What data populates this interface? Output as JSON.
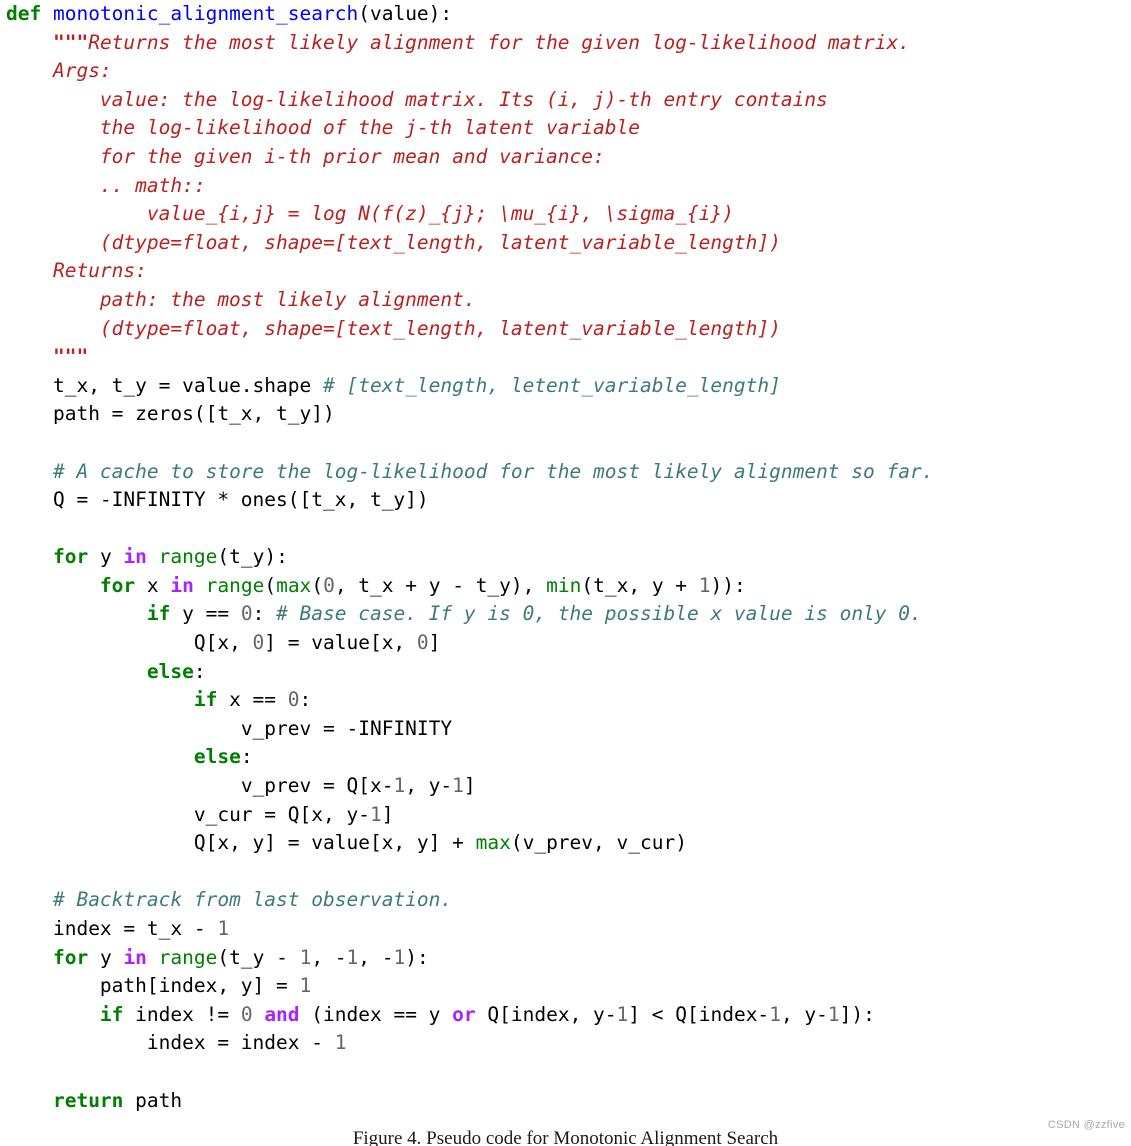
{
  "figure": {
    "caption": "Figure 4. Pseudo code for Monotonic Alignment Search",
    "watermark": "CSDN @zzfive",
    "language": "python"
  },
  "colors": {
    "keyword": "#007f00",
    "operator_keyword": "#aa22ff",
    "function_name": "#0000ff",
    "builtin": "#008000",
    "docstring": "#ba2121",
    "comment": "#3d7b7b",
    "number": "#666666",
    "plain": "#000000",
    "background": "#ffffff",
    "watermark": "#a8a8a8"
  },
  "code": {
    "lines": [
      {
        "id": "l1",
        "indent": 0,
        "tokens": [
          {
            "t": "kw",
            "v": "def"
          },
          {
            "t": "plain",
            "v": " "
          },
          {
            "t": "fname",
            "v": "monotonic_alignment_search"
          },
          {
            "t": "plain",
            "v": "(value):"
          }
        ]
      },
      {
        "id": "l2",
        "indent": 1,
        "tokens": [
          {
            "t": "doc-q",
            "v": "\"\"\""
          },
          {
            "t": "doc",
            "v": "Returns the most likely alignment for the given log-likelihood matrix."
          }
        ]
      },
      {
        "id": "l3",
        "indent": 1,
        "tokens": [
          {
            "t": "doc",
            "v": "Args:"
          }
        ]
      },
      {
        "id": "l4",
        "indent": 2,
        "tokens": [
          {
            "t": "doc",
            "v": "value: the log-likelihood matrix. Its (i, j)-th entry contains"
          }
        ]
      },
      {
        "id": "l5",
        "indent": 2,
        "tokens": [
          {
            "t": "doc",
            "v": "the log-likelihood of the j-th latent variable"
          }
        ]
      },
      {
        "id": "l6",
        "indent": 2,
        "tokens": [
          {
            "t": "doc",
            "v": "for the given i-th prior mean and variance:"
          }
        ]
      },
      {
        "id": "l7",
        "indent": 2,
        "tokens": [
          {
            "t": "doc",
            "v": ".. math::"
          }
        ]
      },
      {
        "id": "l8",
        "indent": 3,
        "tokens": [
          {
            "t": "doc",
            "v": "value_{i,j} = log N(f(z)_{j}; \\mu_{i}, \\sigma_{i})"
          }
        ]
      },
      {
        "id": "l9",
        "indent": 2,
        "tokens": [
          {
            "t": "doc",
            "v": "(dtype=float, shape=[text_length, latent_variable_length])"
          }
        ]
      },
      {
        "id": "l10",
        "indent": 1,
        "tokens": [
          {
            "t": "doc",
            "v": "Returns:"
          }
        ]
      },
      {
        "id": "l11",
        "indent": 2,
        "tokens": [
          {
            "t": "doc",
            "v": "path: the most likely alignment."
          }
        ]
      },
      {
        "id": "l12",
        "indent": 2,
        "tokens": [
          {
            "t": "doc",
            "v": "(dtype=float, shape=[text_length, latent_variable_length])"
          }
        ]
      },
      {
        "id": "l13",
        "indent": 1,
        "tokens": [
          {
            "t": "doc-q",
            "v": "\"\"\""
          }
        ]
      },
      {
        "id": "l14",
        "indent": 1,
        "tokens": [
          {
            "t": "plain",
            "v": "t_x, t_y = value.shape "
          },
          {
            "t": "comment",
            "v": "# [text_length, letent_variable_length]"
          }
        ]
      },
      {
        "id": "l15",
        "indent": 1,
        "tokens": [
          {
            "t": "plain",
            "v": "path = zeros([t_x, t_y])"
          }
        ]
      },
      {
        "id": "l16",
        "indent": 0,
        "tokens": []
      },
      {
        "id": "l17",
        "indent": 1,
        "tokens": [
          {
            "t": "comment",
            "v": "# A cache to store the log-likelihood for the most likely alignment so far."
          }
        ]
      },
      {
        "id": "l18",
        "indent": 1,
        "tokens": [
          {
            "t": "plain",
            "v": "Q = -INFINITY * ones([t_x, t_y])"
          }
        ]
      },
      {
        "id": "l19",
        "indent": 0,
        "tokens": []
      },
      {
        "id": "l20",
        "indent": 1,
        "tokens": [
          {
            "t": "kw",
            "v": "for"
          },
          {
            "t": "plain",
            "v": " y "
          },
          {
            "t": "op-kw",
            "v": "in"
          },
          {
            "t": "plain",
            "v": " "
          },
          {
            "t": "builtin",
            "v": "range"
          },
          {
            "t": "plain",
            "v": "(t_y):"
          }
        ]
      },
      {
        "id": "l21",
        "indent": 2,
        "tokens": [
          {
            "t": "kw",
            "v": "for"
          },
          {
            "t": "plain",
            "v": " x "
          },
          {
            "t": "op-kw",
            "v": "in"
          },
          {
            "t": "plain",
            "v": " "
          },
          {
            "t": "builtin",
            "v": "range"
          },
          {
            "t": "plain",
            "v": "("
          },
          {
            "t": "builtin",
            "v": "max"
          },
          {
            "t": "plain",
            "v": "("
          },
          {
            "t": "num",
            "v": "0"
          },
          {
            "t": "plain",
            "v": ", t_x + y - t_y), "
          },
          {
            "t": "builtin",
            "v": "min"
          },
          {
            "t": "plain",
            "v": "(t_x, y + "
          },
          {
            "t": "num",
            "v": "1"
          },
          {
            "t": "plain",
            "v": ")):"
          }
        ]
      },
      {
        "id": "l22",
        "indent": 3,
        "tokens": [
          {
            "t": "kw",
            "v": "if"
          },
          {
            "t": "plain",
            "v": " y == "
          },
          {
            "t": "num",
            "v": "0"
          },
          {
            "t": "plain",
            "v": ": "
          },
          {
            "t": "comment",
            "v": "# Base case. If y is 0, the possible x value is only 0."
          }
        ]
      },
      {
        "id": "l23",
        "indent": 4,
        "tokens": [
          {
            "t": "plain",
            "v": "Q[x, "
          },
          {
            "t": "num",
            "v": "0"
          },
          {
            "t": "plain",
            "v": "] = value[x, "
          },
          {
            "t": "num",
            "v": "0"
          },
          {
            "t": "plain",
            "v": "]"
          }
        ]
      },
      {
        "id": "l24",
        "indent": 3,
        "tokens": [
          {
            "t": "kw",
            "v": "else"
          },
          {
            "t": "plain",
            "v": ":"
          }
        ]
      },
      {
        "id": "l25",
        "indent": 4,
        "tokens": [
          {
            "t": "kw",
            "v": "if"
          },
          {
            "t": "plain",
            "v": " x == "
          },
          {
            "t": "num",
            "v": "0"
          },
          {
            "t": "plain",
            "v": ":"
          }
        ]
      },
      {
        "id": "l26",
        "indent": 5,
        "tokens": [
          {
            "t": "plain",
            "v": "v_prev = -INFINITY"
          }
        ]
      },
      {
        "id": "l27",
        "indent": 4,
        "tokens": [
          {
            "t": "kw",
            "v": "else"
          },
          {
            "t": "plain",
            "v": ":"
          }
        ]
      },
      {
        "id": "l28",
        "indent": 5,
        "tokens": [
          {
            "t": "plain",
            "v": "v_prev = Q[x-"
          },
          {
            "t": "num",
            "v": "1"
          },
          {
            "t": "plain",
            "v": ", y-"
          },
          {
            "t": "num",
            "v": "1"
          },
          {
            "t": "plain",
            "v": "]"
          }
        ]
      },
      {
        "id": "l29",
        "indent": 4,
        "tokens": [
          {
            "t": "plain",
            "v": "v_cur = Q[x, y-"
          },
          {
            "t": "num",
            "v": "1"
          },
          {
            "t": "plain",
            "v": "]"
          }
        ]
      },
      {
        "id": "l30",
        "indent": 4,
        "tokens": [
          {
            "t": "plain",
            "v": "Q[x, y] = value[x, y] + "
          },
          {
            "t": "builtin",
            "v": "max"
          },
          {
            "t": "plain",
            "v": "(v_prev, v_cur)"
          }
        ]
      },
      {
        "id": "l31",
        "indent": 0,
        "tokens": []
      },
      {
        "id": "l32",
        "indent": 1,
        "tokens": [
          {
            "t": "comment",
            "v": "# Backtrack from last observation."
          }
        ]
      },
      {
        "id": "l33",
        "indent": 1,
        "tokens": [
          {
            "t": "plain",
            "v": "index = t_x - "
          },
          {
            "t": "num",
            "v": "1"
          }
        ]
      },
      {
        "id": "l34",
        "indent": 1,
        "tokens": [
          {
            "t": "kw",
            "v": "for"
          },
          {
            "t": "plain",
            "v": " y "
          },
          {
            "t": "op-kw",
            "v": "in"
          },
          {
            "t": "plain",
            "v": " "
          },
          {
            "t": "builtin",
            "v": "range"
          },
          {
            "t": "plain",
            "v": "(t_y - "
          },
          {
            "t": "num",
            "v": "1"
          },
          {
            "t": "plain",
            "v": ", -"
          },
          {
            "t": "num",
            "v": "1"
          },
          {
            "t": "plain",
            "v": ", -"
          },
          {
            "t": "num",
            "v": "1"
          },
          {
            "t": "plain",
            "v": "):"
          }
        ]
      },
      {
        "id": "l35",
        "indent": 2,
        "tokens": [
          {
            "t": "plain",
            "v": "path[index, y] = "
          },
          {
            "t": "num",
            "v": "1"
          }
        ]
      },
      {
        "id": "l36",
        "indent": 2,
        "tokens": [
          {
            "t": "kw",
            "v": "if"
          },
          {
            "t": "plain",
            "v": " index != "
          },
          {
            "t": "num",
            "v": "0"
          },
          {
            "t": "plain",
            "v": " "
          },
          {
            "t": "op-kw",
            "v": "and"
          },
          {
            "t": "plain",
            "v": " (index == y "
          },
          {
            "t": "op-kw",
            "v": "or"
          },
          {
            "t": "plain",
            "v": " Q[index, y-"
          },
          {
            "t": "num",
            "v": "1"
          },
          {
            "t": "plain",
            "v": "] < Q[index-"
          },
          {
            "t": "num",
            "v": "1"
          },
          {
            "t": "plain",
            "v": ", y-"
          },
          {
            "t": "num",
            "v": "1"
          },
          {
            "t": "plain",
            "v": "]):"
          }
        ]
      },
      {
        "id": "l37",
        "indent": 3,
        "tokens": [
          {
            "t": "plain",
            "v": "index = index - "
          },
          {
            "t": "num",
            "v": "1"
          }
        ]
      },
      {
        "id": "l38",
        "indent": 0,
        "tokens": []
      },
      {
        "id": "l39",
        "indent": 1,
        "tokens": [
          {
            "t": "kw",
            "v": "return"
          },
          {
            "t": "plain",
            "v": " path"
          }
        ]
      }
    ]
  }
}
